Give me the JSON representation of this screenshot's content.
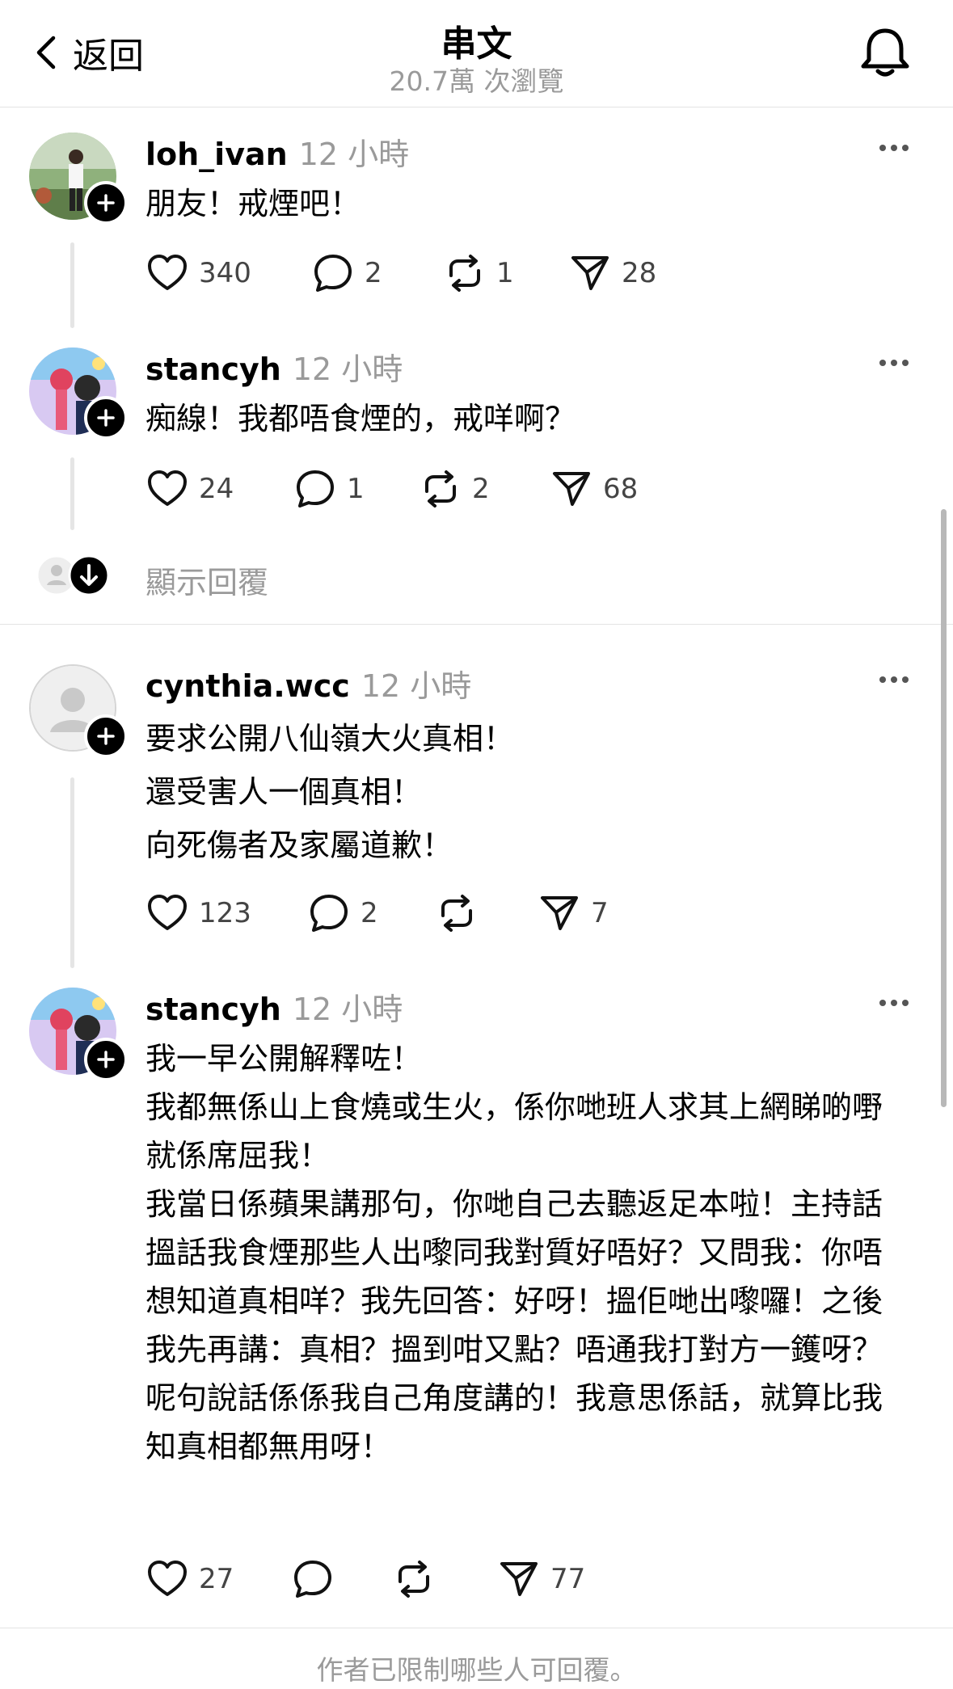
{
  "header": {
    "back_label": "返回",
    "title": "串文",
    "views": "20.7萬 次瀏覽"
  },
  "posts": [
    {
      "username": "loh_ivan",
      "time": "12 小時",
      "lines": [
        "朋友！戒煙吧！"
      ],
      "likes": "340",
      "replies": "2",
      "reposts": "1",
      "shares": "28"
    },
    {
      "username": "stancyh",
      "time": "12 小時",
      "lines": [
        "痴線！我都唔食煙的，戒咩啊？"
      ],
      "likes": "24",
      "replies": "1",
      "reposts": "2",
      "shares": "68"
    },
    {
      "username": "cynthia.wcc",
      "time": "12 小時",
      "lines": [
        "要求公開八仙嶺大火真相！",
        "還受害人一個真相！",
        "向死傷者及家屬道歉！"
      ],
      "likes": "123",
      "replies": "2",
      "reposts": "",
      "shares": "7"
    },
    {
      "username": "stancyh",
      "time": "12 小時",
      "lines": [
        "我一早公開解釋咗！",
        "我都無係山上食燒或生火，係你哋班人求其上網睇啲嘢就係席屈我！",
        "我當日係蘋果講那句，你哋自己去聽返足本啦！主持話搵話我食煙那些人出嚟同我對質好唔好？又問我：你唔想知道真相咩？我先回答：好呀！搵佢哋出嚟囉！之後我先再講：真相？搵到咁又點？唔通我打對方一鑊呀？",
        "呢句說話係係我自己角度講的！我意思係話，就算比我知真相都無用呀！"
      ],
      "likes": "27",
      "replies": "",
      "reposts": "",
      "shares": "77"
    }
  ],
  "show_replies": "顯示回覆",
  "footer": "作者已限制哪些人可回覆。"
}
